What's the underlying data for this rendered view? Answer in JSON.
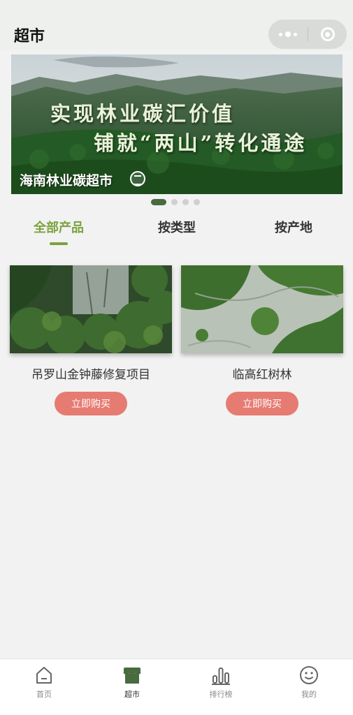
{
  "header": {
    "title": "超市"
  },
  "banner": {
    "line1": "实现林业碳汇价值",
    "line2": "铺就“两山”转化通途",
    "brand": "海南林业碳超市",
    "slide_count": 4,
    "active_slide": 1
  },
  "tabs": [
    {
      "label": "全部产品",
      "active": true
    },
    {
      "label": "按类型",
      "active": false
    },
    {
      "label": "按产地",
      "active": false
    }
  ],
  "products": [
    {
      "name": "吊罗山金钟藤修复项目",
      "button": "立即购买",
      "image": "forest-canopy-photo"
    },
    {
      "name": "临高红树林",
      "button": "立即购买",
      "image": "mangrove-aerial-photo"
    }
  ],
  "tabbar": [
    {
      "label": "首页",
      "icon": "home-icon",
      "active": false
    },
    {
      "label": "超市",
      "icon": "shop-icon",
      "active": true
    },
    {
      "label": "排行榜",
      "icon": "ranking-icon",
      "active": false
    },
    {
      "label": "我的",
      "icon": "smile-face-icon",
      "active": false
    }
  ],
  "colors": {
    "accent_green": "#7aa33c",
    "dark_green": "#486b3f",
    "buy_button": "#e67b72"
  }
}
